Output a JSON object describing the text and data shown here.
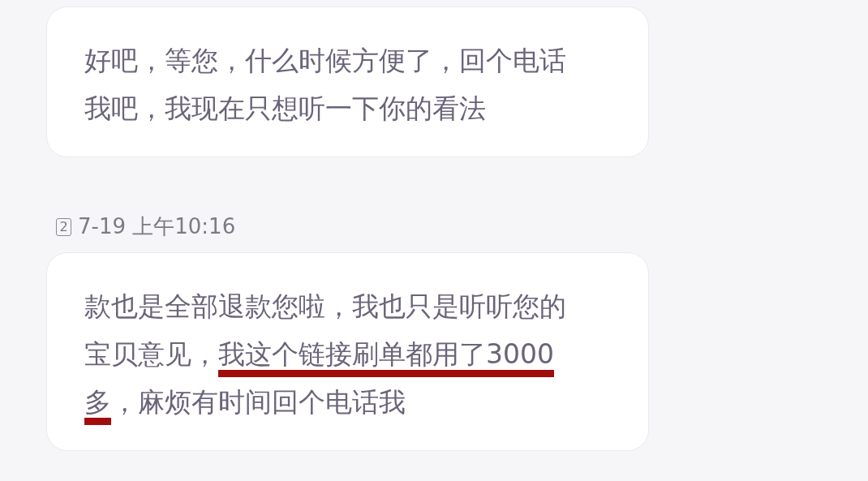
{
  "messages": [
    {
      "kind": "bubble",
      "segments": [
        {
          "text": "好吧，等您，什么时候方便了，回个电话我吧，我现在只想听一下你的看法",
          "underlined": false
        }
      ]
    },
    {
      "kind": "timestamp",
      "sim": "2",
      "time": "7-19 上午10:16"
    },
    {
      "kind": "bubble",
      "segments": [
        {
          "text": "款也是全部退款您啦，我也只是听听您的宝贝意见，",
          "underlined": false
        },
        {
          "text": "我这个链接刷单都用了3000多",
          "underlined": true
        },
        {
          "text": "，麻烦有时间回个电话我",
          "underlined": false
        }
      ]
    }
  ]
}
